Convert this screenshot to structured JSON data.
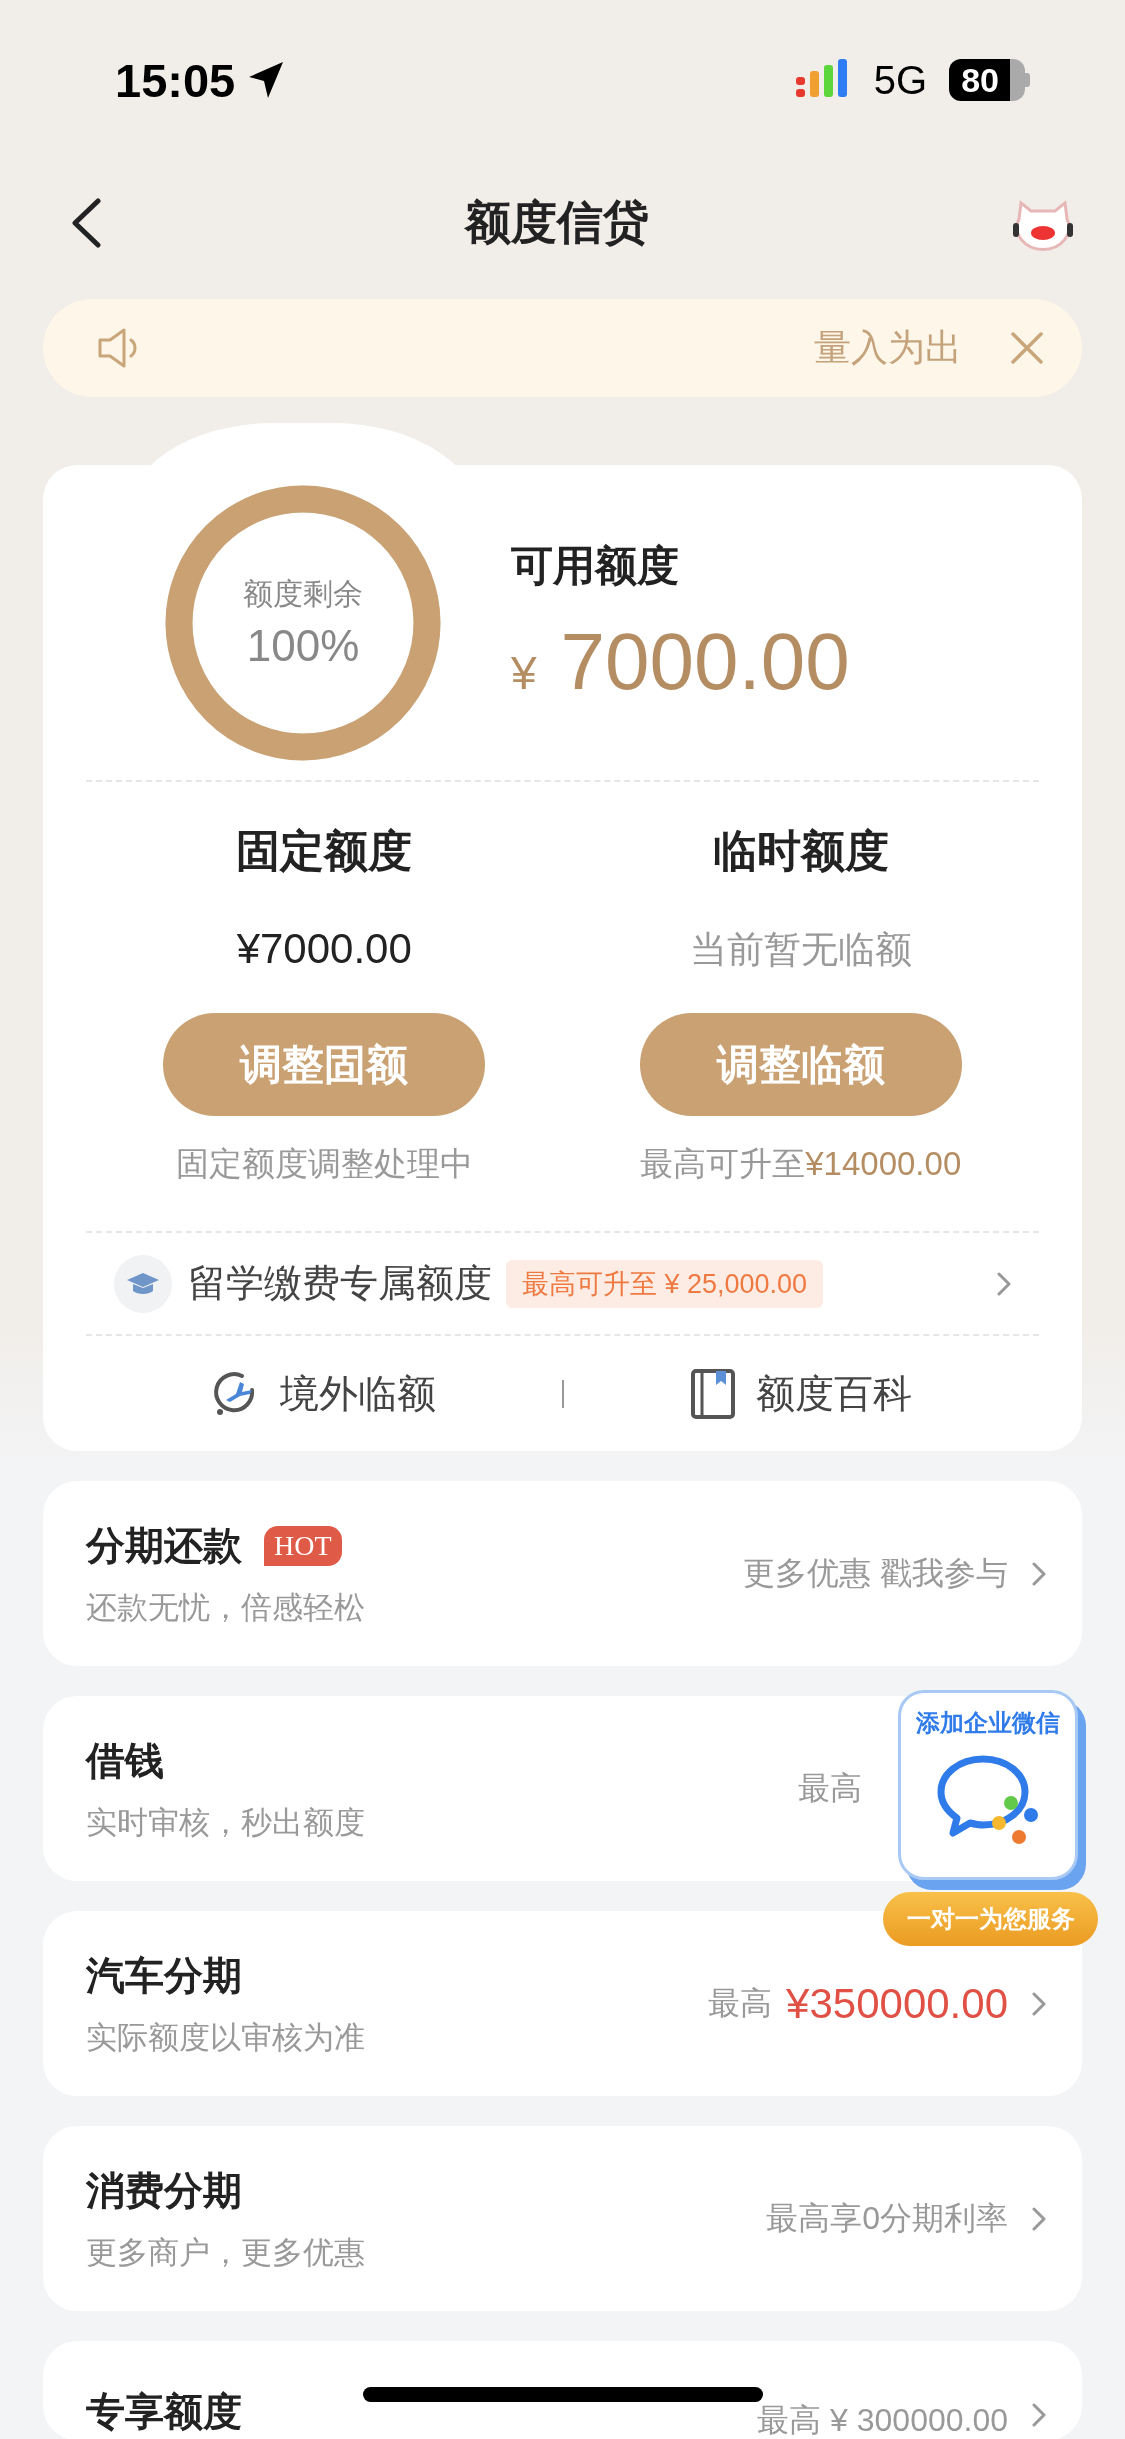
{
  "status_bar": {
    "time": "15:05",
    "network": "5G",
    "battery": "80"
  },
  "nav": {
    "title": "额度信贷"
  },
  "notice": {
    "text": "量入为出"
  },
  "credit": {
    "ring_label": "额度剩余",
    "ring_value": "100%",
    "available_label": "可用额度",
    "currency": "¥",
    "available_amount": "7000.00",
    "quotas": [
      {
        "title": "固定额度",
        "amount": "¥7000.00",
        "kind": "amount",
        "button": "调整固额",
        "note": "固定额度调整处理中"
      },
      {
        "title": "临时额度",
        "amount": "当前暂无临额",
        "kind": "empty",
        "button": "调整临额",
        "note": "最高可升至",
        "note_amount": "¥14000.00"
      }
    ],
    "study": {
      "label": "留学缴费专属额度",
      "tag": "最高可升至 ¥ 25,000.00"
    },
    "links": [
      {
        "label": "境外临额",
        "kind": "plane"
      },
      {
        "label": "额度百科",
        "kind": "book"
      }
    ]
  },
  "services": [
    {
      "title": "分期还款",
      "badge": "HOT",
      "subtitle": "还款无忧，倍感轻松",
      "value": "更多优惠 戳我参与",
      "kind": "text"
    },
    {
      "title": "借钱",
      "subtitle": "实时审核，秒出额度",
      "value_label": "最高"
    },
    {
      "title": "汽车分期",
      "subtitle": "实际额度以审核为准",
      "value_label": "最高",
      "value": "¥350000.00",
      "kind": "amount"
    },
    {
      "title": "消费分期",
      "subtitle": "更多商户，更多优惠",
      "value": "最高享0分期利率",
      "kind": "text"
    },
    {
      "title": "专享额度",
      "value": "最高 ¥ 300000.00",
      "kind": "text"
    }
  ],
  "widget": {
    "title": "添加企业微信",
    "caption": "一对一为您服务"
  }
}
